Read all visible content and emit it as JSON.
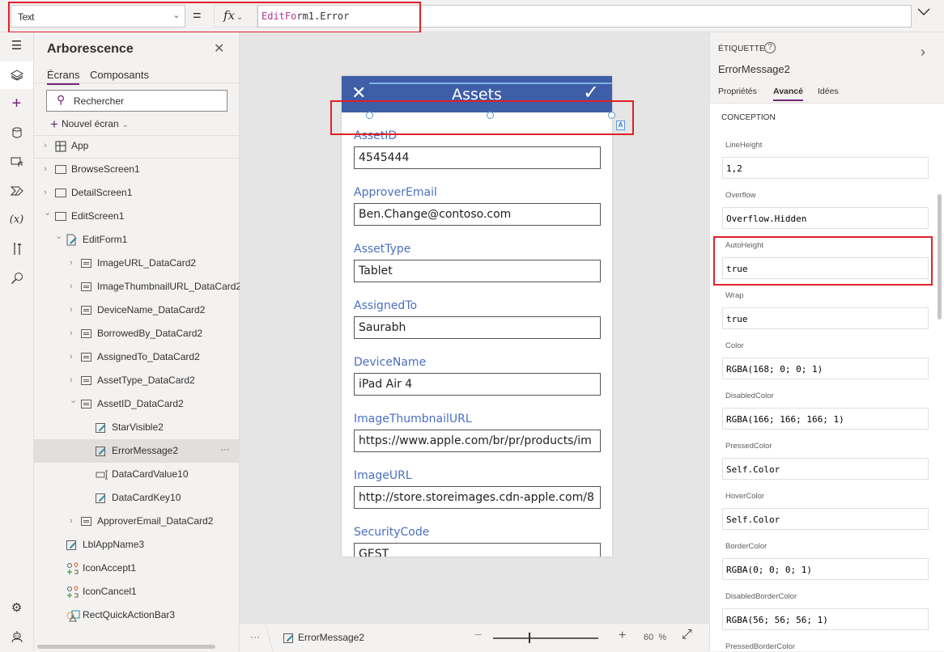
{
  "formula_bar": {
    "property": "Text",
    "fx_label": "fx",
    "formula_keyword": "EditFo",
    "formula_rest": "rm1.Error"
  },
  "rail": {
    "icons": [
      "hamburger-menu",
      "tree-view",
      "insert",
      "data",
      "media",
      "power-automate",
      "variables",
      "advanced-tools",
      "search"
    ],
    "bottom_icons": [
      "settings",
      "virtual-agent"
    ]
  },
  "tree": {
    "title": "Arborescence",
    "tabs": [
      "Écrans",
      "Composants"
    ],
    "search_placeholder": "Rechercher",
    "new_screen": "Nouvel écran",
    "nodes": [
      {
        "label": "App",
        "type": "app",
        "level": 0,
        "chevron": "right"
      },
      {
        "label": "BrowseScreen1",
        "type": "screen",
        "level": 0,
        "chevron": "right"
      },
      {
        "label": "DetailScreen1",
        "type": "screen",
        "level": 0,
        "chevron": "right"
      },
      {
        "label": "EditScreen1",
        "type": "screen",
        "level": 0,
        "chevron": "down"
      },
      {
        "label": "EditForm1",
        "type": "form",
        "level": 1,
        "chevron": "down"
      },
      {
        "label": "ImageURL_DataCard2",
        "type": "card",
        "level": 2,
        "chevron": "right"
      },
      {
        "label": "ImageThumbnailURL_DataCard2",
        "type": "card",
        "level": 2,
        "chevron": "right"
      },
      {
        "label": "DeviceName_DataCard2",
        "type": "card",
        "level": 2,
        "chevron": "right"
      },
      {
        "label": "BorrowedBy_DataCard2",
        "type": "card",
        "level": 2,
        "chevron": "right"
      },
      {
        "label": "AssignedTo_DataCard2",
        "type": "card",
        "level": 2,
        "chevron": "right"
      },
      {
        "label": "AssetType_DataCard2",
        "type": "card",
        "level": 2,
        "chevron": "right"
      },
      {
        "label": "AssetID_DataCard2",
        "type": "card",
        "level": 2,
        "chevron": "down"
      },
      {
        "label": "StarVisible2",
        "type": "label",
        "level": 3,
        "chevron": ""
      },
      {
        "label": "ErrorMessage2",
        "type": "label",
        "level": 3,
        "chevron": "",
        "selected": true
      },
      {
        "label": "DataCardValue10",
        "type": "textinput",
        "level": 3,
        "chevron": ""
      },
      {
        "label": "DataCardKey10",
        "type": "label",
        "level": 3,
        "chevron": ""
      },
      {
        "label": "ApproverEmail_DataCard2",
        "type": "card",
        "level": 2,
        "chevron": "right"
      },
      {
        "label": "LblAppName3",
        "type": "label",
        "level": 1,
        "chevron": ""
      },
      {
        "label": "IconAccept1",
        "type": "icon",
        "level": 1,
        "chevron": ""
      },
      {
        "label": "IconCancel1",
        "type": "icon",
        "level": 1,
        "chevron": ""
      },
      {
        "label": "RectQuickActionBar3",
        "type": "shape",
        "level": 1,
        "chevron": ""
      }
    ],
    "more_label": "···"
  },
  "phone": {
    "title": "Assets",
    "header_color": "#3e5ea8",
    "fields": [
      {
        "label": "AssetID",
        "value": "4545444"
      },
      {
        "label": "ApproverEmail",
        "value": "Ben.Change@contoso.com"
      },
      {
        "label": "AssetType",
        "value": "Tablet"
      },
      {
        "label": "AssignedTo",
        "value": "Saurabh"
      },
      {
        "label": "DeviceName",
        "value": "iPad Air 4"
      },
      {
        "label": "ImageThumbnailURL",
        "value": "https://www.apple.com/br/pr/products/im"
      },
      {
        "label": "ImageURL",
        "value": "http://store.storeimages.cdn-apple.com/8"
      },
      {
        "label": "SecurityCode",
        "value": "GEST"
      }
    ],
    "selection_badge": "A"
  },
  "statusbar": {
    "more": "···",
    "selected": "ErrorMessage2",
    "zoom_value": "60",
    "zoom_unit": "%"
  },
  "props": {
    "control_type": "ÉTIQUETTE",
    "help": "?",
    "control_name": "ErrorMessage2",
    "tabs": [
      "Propriétés",
      "Avancé",
      "Idées"
    ],
    "active_tab": "Avancé",
    "section": "CONCEPTION",
    "rows": [
      {
        "name": "LineHeight",
        "value": "1,2"
      },
      {
        "name": "Overflow",
        "value": "Overflow.Hidden"
      },
      {
        "name": "AutoHeight",
        "value": "true",
        "highlighted": true
      },
      {
        "name": "Wrap",
        "value": "true"
      },
      {
        "name": "Color",
        "value": "RGBA(168; 0; 0; 1)"
      },
      {
        "name": "DisabledColor",
        "value": "RGBA(166; 166; 166; 1)"
      },
      {
        "name": "PressedColor",
        "value": "Self.Color"
      },
      {
        "name": "HoverColor",
        "value": "Self.Color"
      },
      {
        "name": "BorderColor",
        "value": "RGBA(0; 0; 0; 1)"
      },
      {
        "name": "DisabledBorderColor",
        "value": "RGBA(56; 56; 56; 1)"
      },
      {
        "name": "PressedBorderColor",
        "value": ""
      }
    ]
  },
  "colors": {
    "accent": "#742774",
    "highlight": "#e0202a",
    "field_label": "#4a6fc1"
  }
}
